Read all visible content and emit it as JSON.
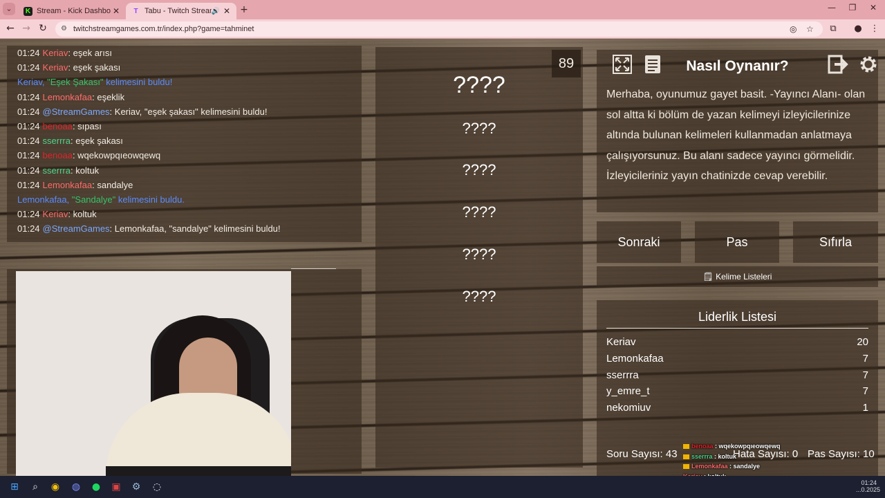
{
  "browser": {
    "tabs": [
      {
        "title": "Stream - Kick Dashboard",
        "favicon": "K",
        "active": false
      },
      {
        "title": "Tabu - Twitch Stream Game",
        "favicon": "T",
        "active": true
      }
    ],
    "url": "twitchstreamgames.com.tr/index.php?game=tahminet"
  },
  "chat": {
    "lines": [
      {
        "time": "01:24",
        "user": "Keriav",
        "user_color": "red",
        "text": ": eşek arısı"
      },
      {
        "time": "01:24",
        "user": "Keriav",
        "user_color": "red",
        "text": ": eşek şakası"
      },
      {
        "system": true,
        "user": "Keriav,",
        "word": " \"Eşek Şakası\"",
        "text": " kelimesini buldu!"
      },
      {
        "time": "01:24",
        "user": "Lemonkafaa",
        "user_color": "red",
        "text": ": eşeklik"
      },
      {
        "time": "01:24",
        "user": "@StreamGames",
        "user_color": "blue",
        "text": ": Keriav, \"eşek şakası\" kelimesini buldu!"
      },
      {
        "time": "01:24",
        "user": "benoaa",
        "user_color": "dred",
        "text": ": sıpası"
      },
      {
        "time": "01:24",
        "user": "sserrra",
        "user_color": "green",
        "text": ": eşek şakası"
      },
      {
        "time": "01:24",
        "user": "benoaa",
        "user_color": "dred",
        "text": ": wqekowpqıeowqewq"
      },
      {
        "time": "01:24",
        "user": "sserrra",
        "user_color": "green",
        "text": ": koltuk"
      },
      {
        "time": "01:24",
        "user": "Lemonkafaa",
        "user_color": "red",
        "text": ": sandalye"
      },
      {
        "system": true,
        "user": "Lemonkafaa,",
        "word": " \"Sandalye\"",
        "text": " kelimesini buldu."
      },
      {
        "time": "01:24",
        "user": "Keriav",
        "user_color": "red",
        "text": ": koltuk"
      },
      {
        "time": "01:24",
        "user": "@StreamGames",
        "user_color": "blue",
        "text": ": Lemonkafaa, \"sandalye\" kelimesini buldu!"
      }
    ]
  },
  "game": {
    "counter": "89",
    "main_word": "????",
    "forbidden_words": [
      "????",
      "????",
      "????",
      "????",
      "????"
    ]
  },
  "howto": {
    "title": "Nasıl Oynanır?",
    "body": "Merhaba, oyunumuz gayet basit. -Yayıncı Alanı- olan sol altta ki bölüm de yazan kelimeyi izleyicilerinize altında bulunan kelimeleri kullanmadan anlatmaya çalışıyorsunuz. Bu alanı sadece yayıncı görmelidir. İzleyicileriniz yayın chatinizde cevap verebilir."
  },
  "buttons": {
    "next": "Sonraki",
    "pass": "Pas",
    "reset": "Sıfırla",
    "word_lists": "Kelime Listeleri"
  },
  "leaderboard": {
    "title": "Liderlik Listesi",
    "rows": [
      {
        "name": "Keriav",
        "score": "20"
      },
      {
        "name": "Lemonkafaa",
        "score": "7"
      },
      {
        "name": "sserrra",
        "score": "7"
      },
      {
        "name": "y_emre_t",
        "score": "7"
      },
      {
        "name": "nekomiuv",
        "score": "1"
      }
    ]
  },
  "stats": {
    "questions": "Soru Sayısı: 43",
    "errors": "Hata Sayısı: 0",
    "passes": "Pas Sayısı: 10"
  },
  "overlay_chat": [
    {
      "user": "benoaa",
      "text": " : wqekowpqıeowqewq"
    },
    {
      "user": "sserrra",
      "text": " : koltuk"
    },
    {
      "user": "Lemonkafaa",
      "text": " : sandalye"
    },
    {
      "user": "Keriav",
      "text": " : koltuk"
    },
    {
      "user": "@StreamGames",
      "text": " : Lemonkafaa, \"sandalye\" kelimesini buldu!"
    }
  ],
  "taskbar": {
    "time": "01:24",
    "date": "...0.2025"
  },
  "colors": {
    "chrome_accent": "#e6a6ae",
    "username_red": "#ff6b6b",
    "username_green": "#4fd38a",
    "username_blue": "#7aa8ff",
    "system_blue": "#5a8cff"
  }
}
